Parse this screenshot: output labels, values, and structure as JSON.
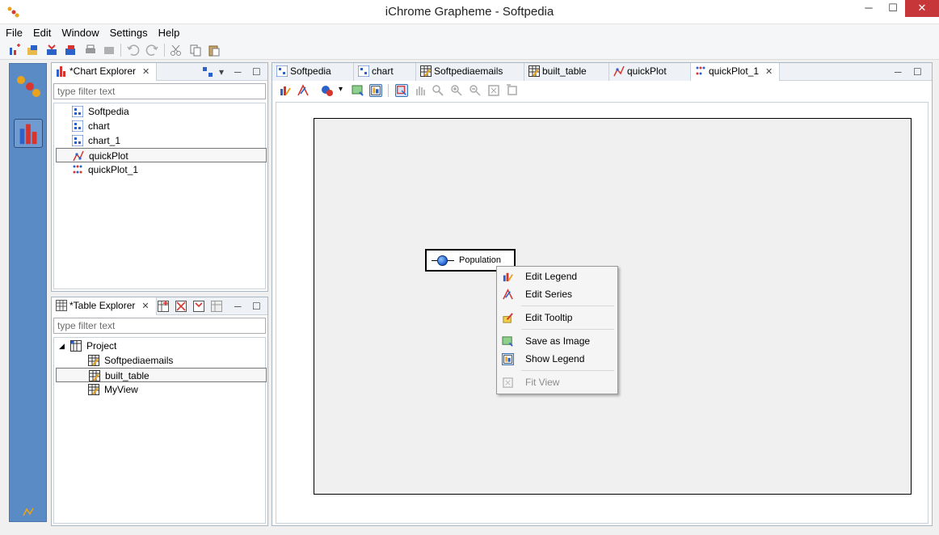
{
  "window": {
    "title": "iChrome Grapheme - Softpedia",
    "minimize": "─",
    "maximize": "☐",
    "close": "✕"
  },
  "menu": [
    "File",
    "Edit",
    "Window",
    "Settings",
    "Help"
  ],
  "chart_explorer": {
    "tab_label": "*Chart Explorer",
    "filter_placeholder": "type filter text",
    "items": [
      "Softpedia",
      "chart",
      "chart_1",
      "quickPlot",
      "quickPlot_1"
    ]
  },
  "table_explorer": {
    "tab_label": "*Table Explorer",
    "filter_placeholder": "type filter text",
    "root": "Project",
    "items": [
      "Softpediaemails",
      "built_table",
      "MyView"
    ]
  },
  "editor": {
    "tabs": [
      "Softpedia",
      "chart",
      "Softpediaemails",
      "built_table",
      "quickPlot",
      "quickPlot_1"
    ],
    "legend_label": "Population"
  },
  "context_menu": {
    "items": [
      "Edit Legend",
      "Edit Series",
      "Edit Tooltip",
      "Save as Image",
      "Show Legend",
      "Fit View"
    ]
  },
  "colors": {
    "perspective_bar": "#5a8bc4",
    "close_button": "#c7373a",
    "legend_dot": "#1f5fd0"
  }
}
